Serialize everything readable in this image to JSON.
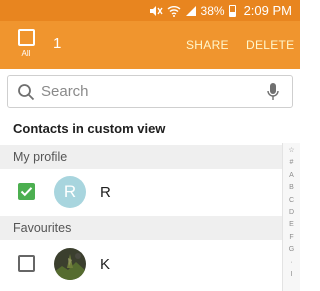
{
  "status_bar": {
    "battery": "38%",
    "time": "2:09 PM",
    "icons": [
      "mute-icon",
      "wifi-icon",
      "signal-icon",
      "battery-icon"
    ]
  },
  "action_bar": {
    "select_all_label": "All",
    "selected_count": "1",
    "share_label": "SHARE",
    "delete_label": "DELETE"
  },
  "search": {
    "placeholder": "Search"
  },
  "list": {
    "title": "Contacts in custom view",
    "groups": [
      {
        "header": "My profile",
        "contacts": [
          {
            "initial": "R",
            "name": "R",
            "checked": true
          }
        ]
      },
      {
        "header": "Favourites",
        "contacts": [
          {
            "initial": "",
            "name": "K",
            "checked": false
          }
        ]
      }
    ]
  },
  "index_bar": [
    "☆",
    "#",
    "A",
    "B",
    "C",
    "D",
    "E",
    "F",
    "G",
    "·",
    "I"
  ],
  "colors": {
    "status_bar": "#e8851f",
    "action_bar": "#f0952e",
    "action_text": "#fff7cc",
    "checked": "#4caf50",
    "avatar_r": "#a8d5de"
  }
}
